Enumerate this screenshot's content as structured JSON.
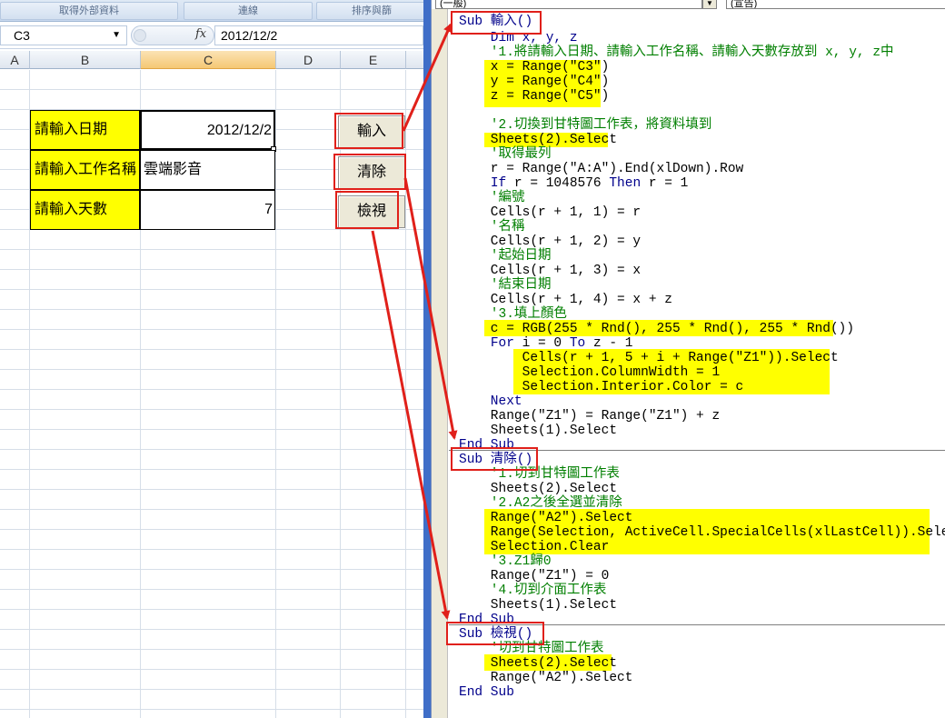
{
  "colors": {
    "accent_red": "#e0201a",
    "highlight_yellow": "#ffff00",
    "splitter_blue": "#3f6ec8",
    "vba_keyword": "#00008b",
    "vba_comment": "#007f00"
  },
  "excel": {
    "ribbon": {
      "items": [
        "取得外部資料",
        "連線",
        "排序與篩"
      ]
    },
    "formula_bar": {
      "name_box": "C3",
      "fx_label": "fx",
      "formula": "2012/12/2"
    },
    "columns": [
      {
        "label": "A",
        "active": false
      },
      {
        "label": "B",
        "active": false
      },
      {
        "label": "C",
        "active": true
      },
      {
        "label": "D",
        "active": false
      },
      {
        "label": "E",
        "active": false
      }
    ],
    "form": {
      "rows": [
        {
          "label": "請輸入日期",
          "value": "2012/12/2",
          "align": "right"
        },
        {
          "label": "請輸入工作名稱",
          "value": "雲端影音",
          "align": "left"
        },
        {
          "label": "請輸入天數",
          "value": "7",
          "align": "right"
        }
      ]
    },
    "buttons": [
      {
        "label": "輸入",
        "icon": "none"
      },
      {
        "label": "清除",
        "icon": "none"
      },
      {
        "label": "檢視",
        "icon": "none"
      }
    ]
  },
  "vbe": {
    "object_combo": "(一般)",
    "proc_combo": "(宣告)",
    "code": [
      {
        "text": "Sub 輸入()",
        "type": "kw"
      },
      {
        "text": "    Dim x, y, z",
        "type": "kw"
      },
      {
        "text": "    '1.將請輸入日期、請輸入工作名稱、請輸入天數存放到 x, y, z中",
        "type": "cm"
      },
      {
        "text": "    x = Range(\"C3\")",
        "type": "plain"
      },
      {
        "text": "    y = Range(\"C4\")",
        "type": "plain"
      },
      {
        "text": "    z = Range(\"C5\")",
        "type": "plain"
      },
      {
        "text": "",
        "type": "plain"
      },
      {
        "text": "    '2.切換到甘特圖工作表，將資料填到",
        "type": "cm"
      },
      {
        "text": "    Sheets(2).Select",
        "type": "plain"
      },
      {
        "text": "    '取得最列",
        "type": "cm"
      },
      {
        "text": "    r = Range(\"A:A\").End(xlDown).Row",
        "type": "plain"
      },
      {
        "text": "    If r = 1048576 Then r = 1",
        "type": "mixed"
      },
      {
        "text": "    '編號",
        "type": "cm"
      },
      {
        "text": "    Cells(r + 1, 1) = r",
        "type": "plain"
      },
      {
        "text": "    '名稱",
        "type": "cm"
      },
      {
        "text": "    Cells(r + 1, 2) = y",
        "type": "plain"
      },
      {
        "text": "    '起始日期",
        "type": "cm"
      },
      {
        "text": "    Cells(r + 1, 3) = x",
        "type": "plain"
      },
      {
        "text": "    '結束日期",
        "type": "cm"
      },
      {
        "text": "    Cells(r + 1, 4) = x + z",
        "type": "plain"
      },
      {
        "text": "    '3.填上顏色",
        "type": "cm"
      },
      {
        "text": "    c = RGB(255 * Rnd(), 255 * Rnd(), 255 * Rnd())",
        "type": "plain"
      },
      {
        "text": "    For i = 0 To z - 1",
        "type": "mixed"
      },
      {
        "text": "        Cells(r + 1, 5 + i + Range(\"Z1\")).Select",
        "type": "plain"
      },
      {
        "text": "        Selection.ColumnWidth = 1",
        "type": "plain"
      },
      {
        "text": "        Selection.Interior.Color = c",
        "type": "plain"
      },
      {
        "text": "    Next",
        "type": "kw"
      },
      {
        "text": "    Range(\"Z1\") = Range(\"Z1\") + z",
        "type": "plain"
      },
      {
        "text": "    Sheets(1).Select",
        "type": "plain"
      },
      {
        "text": "End Sub",
        "type": "kw"
      },
      {
        "text": "Sub 清除()",
        "type": "kw"
      },
      {
        "text": "    '1.切到甘特圖工作表",
        "type": "cm"
      },
      {
        "text": "    Sheets(2).Select",
        "type": "plain"
      },
      {
        "text": "    '2.A2之後全選並清除",
        "type": "cm"
      },
      {
        "text": "    Range(\"A2\").Select",
        "type": "plain"
      },
      {
        "text": "    Range(Selection, ActiveCell.SpecialCells(xlLastCell)).Select",
        "type": "plain"
      },
      {
        "text": "    Selection.Clear",
        "type": "plain"
      },
      {
        "text": "    '3.Z1歸0",
        "type": "cm"
      },
      {
        "text": "    Range(\"Z1\") = 0",
        "type": "plain"
      },
      {
        "text": "    '4.切到介面工作表",
        "type": "cm"
      },
      {
        "text": "    Sheets(1).Select",
        "type": "plain"
      },
      {
        "text": "End Sub",
        "type": "kw"
      },
      {
        "text": "Sub 檢視()",
        "type": "kw"
      },
      {
        "text": "    '切到甘特圖工作表",
        "type": "cm"
      },
      {
        "text": "    Sheets(2).Select",
        "type": "plain"
      },
      {
        "text": "    Range(\"A2\").Select",
        "type": "plain"
      },
      {
        "text": "End Sub",
        "type": "kw"
      }
    ]
  }
}
